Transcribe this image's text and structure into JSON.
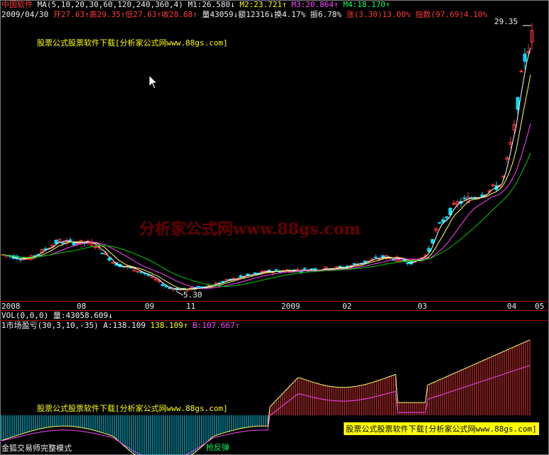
{
  "header": {
    "app_name": "中国软件",
    "ma_label": "MA(5,10,20,30,60,120,240,360,4)",
    "m1": "M1:26.580",
    "m2": "M2:23.721",
    "m3": "M3:20.864",
    "m4": "M4:18.170",
    "date": "2009/04/30",
    "open": "开27.63",
    "high": "高29.35",
    "low": "低27.63",
    "close": "收28.68",
    "volume": "量43059",
    "amount": "额12316",
    "turnover": "换4.17%",
    "amplitude": "振6.78%",
    "rise": "涨(3.30)13.00%",
    "index": "指数(97.69)4.10%"
  },
  "price_panel": {
    "ad_text": "股票公式股票软件下载[分析家公式网www.88gs.com]",
    "max_label": "29.35",
    "min_label": "5.30",
    "watermark": "分析家公式网www.88gs.com"
  },
  "x_axis": [
    "2008",
    "08",
    "09",
    "11",
    "2009",
    "02",
    "03",
    "04",
    "05"
  ],
  "vol_panel": {
    "label": "VOL(0,0,0)",
    "value": "量:43058.609"
  },
  "indicator_panel": {
    "label": "1市场盈亏(30,3,10,-35)",
    "a_value": "A:138.109",
    "second_value": "138.109",
    "b_value": "B:107.667",
    "ad_text": "股票公式股票软件下载[分析家公式网www.88gs.com]",
    "signal_text": "抢反弹",
    "mode_text": "金狐交易师完整模式",
    "banner_text": "股票公式股票软件下载[分析家公式网www.88gs.com]"
  },
  "colors": {
    "up": "#ff3b3b",
    "down": "#00e0ff",
    "ma1": "#ffffff",
    "ma2": "#ffff66",
    "ma3": "#ff44ff",
    "ma4": "#00cc00",
    "axis": "#b00000"
  },
  "chart_data": {
    "type": "line",
    "x": [
      "2008",
      "08",
      "09",
      "11",
      "2009",
      "02",
      "03",
      "04",
      "05"
    ],
    "series": [
      {
        "values": [
          8.8,
          9.6,
          7.6,
          5.3,
          6.8,
          7.7,
          8.4,
          14.5,
          29.35
        ]
      }
    ],
    "ylim": [
      5.3,
      29.35
    ]
  }
}
